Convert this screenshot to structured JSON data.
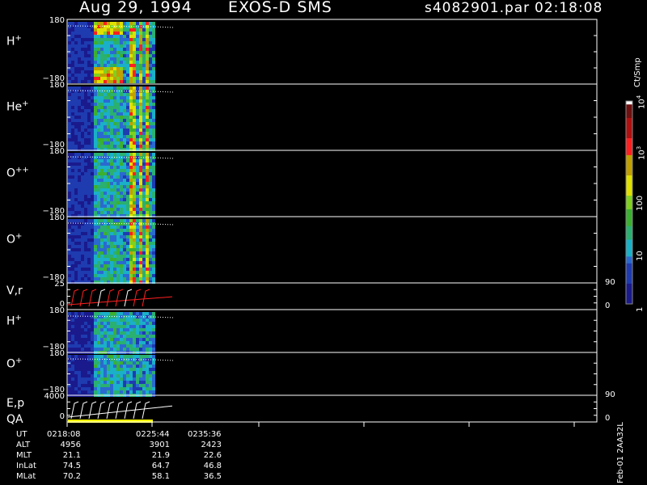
{
  "header": {
    "date": "Aug 29, 1994",
    "instrument": "EXOS-D SMS",
    "file": "s4082901.par",
    "time": "02:18:08"
  },
  "panels": [
    {
      "id": "h_plus_1",
      "label": "H",
      "sup": "+",
      "top": "180",
      "bottom": "−180"
    },
    {
      "id": "he_plus",
      "label": "He",
      "sup": "+",
      "top": "180",
      "bottom": "−180"
    },
    {
      "id": "o_plusplus",
      "label": "O",
      "sup": "++",
      "top": "180",
      "bottom": "−180"
    },
    {
      "id": "o_plus_1",
      "label": "O",
      "sup": "+",
      "top": "180",
      "bottom": "−180"
    },
    {
      "id": "vr",
      "label": "V,r",
      "sup": "",
      "top": "25",
      "bottom": "0",
      "right_top": "90",
      "right_bottom": "0"
    },
    {
      "id": "h_plus_2",
      "label": "H",
      "sup": "+",
      "top": "180",
      "bottom": "−180"
    },
    {
      "id": "o_plus_2",
      "label": "O",
      "sup": "+",
      "top": "180",
      "bottom": "−180"
    },
    {
      "id": "ep",
      "label": "E,p",
      "sup": "",
      "top": "4000",
      "bottom": "0",
      "right_top": "90",
      "right_bottom": "0"
    }
  ],
  "qa_label": "QA",
  "colorbar": {
    "unit": "Ct/Smp",
    "ticks": [
      {
        "text": "1",
        "level": 0
      },
      {
        "text": "10",
        "level": 1
      },
      {
        "text": "100",
        "level": 2
      },
      {
        "text": "10",
        "sup": "3",
        "level": 3
      },
      {
        "text": "10",
        "sup": "4",
        "level": 4
      }
    ]
  },
  "footer": {
    "rows": [
      {
        "label": "UT",
        "values": [
          "0218:08",
          "0225:44",
          "0235:36"
        ]
      },
      {
        "label": "ALT",
        "values": [
          "4956",
          "3901",
          "2423"
        ]
      },
      {
        "label": "MLT",
        "values": [
          "21.1",
          "21.9",
          "22.6"
        ]
      },
      {
        "label": "InLat",
        "values": [
          "74.5",
          "64.7",
          "46.8"
        ]
      },
      {
        "label": "MLat",
        "values": [
          "70.2",
          "58.1",
          "36.5"
        ]
      }
    ],
    "side_note": "Feb-01 2AA32L"
  },
  "chart_data": {
    "type": "heatmap",
    "title": "Aug 29, 1994   EXOS-D SMS",
    "colorscale_unit": "Ct/Smp",
    "colorscale_log_range": [
      0,
      4
    ],
    "time_ticks": [
      "0218:08",
      "0225:44",
      "0235:36"
    ],
    "data_time_range": [
      "0218:08",
      "0225:44"
    ],
    "panels": [
      {
        "name": "H+",
        "ylim": [
          -180,
          180
        ]
      },
      {
        "name": "He+",
        "ylim": [
          -180,
          180
        ]
      },
      {
        "name": "O++",
        "ylim": [
          -180,
          180
        ]
      },
      {
        "name": "O+",
        "ylim": [
          -180,
          180
        ]
      },
      {
        "name": "V,r",
        "ylim": [
          0,
          25
        ],
        "y2lim": [
          0,
          90
        ]
      },
      {
        "name": "H+",
        "ylim": [
          -180,
          180
        ]
      },
      {
        "name": "O+",
        "ylim": [
          -180,
          180
        ]
      },
      {
        "name": "E,p",
        "ylim": [
          0,
          4000
        ],
        "y2lim": [
          0,
          90
        ]
      }
    ]
  }
}
